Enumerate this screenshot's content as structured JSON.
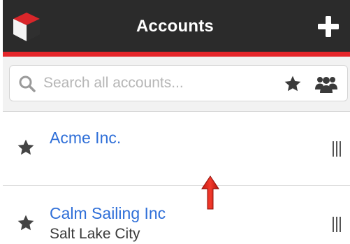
{
  "header": {
    "title": "Accounts",
    "logo_icon": "cube-logo-icon",
    "add_icon": "plus-icon"
  },
  "search": {
    "placeholder": "Search all accounts...",
    "value": "",
    "search_icon": "search-icon",
    "favorites_filter_icon": "star-icon",
    "team_filter_icon": "people-icon"
  },
  "accounts": [
    {
      "name": "Acme Inc.",
      "location": "",
      "icon": "star-icon"
    },
    {
      "name": "Calm Sailing Inc",
      "location": "Salt Lake City",
      "icon": "star-icon"
    }
  ],
  "annotation": {
    "icon": "red-up-arrow-icon"
  },
  "colors": {
    "header_bg": "#2b2b2b",
    "accent_red": "#e5262a",
    "link_blue": "#2f6fd8",
    "search_bg": "#f2f2f2"
  }
}
